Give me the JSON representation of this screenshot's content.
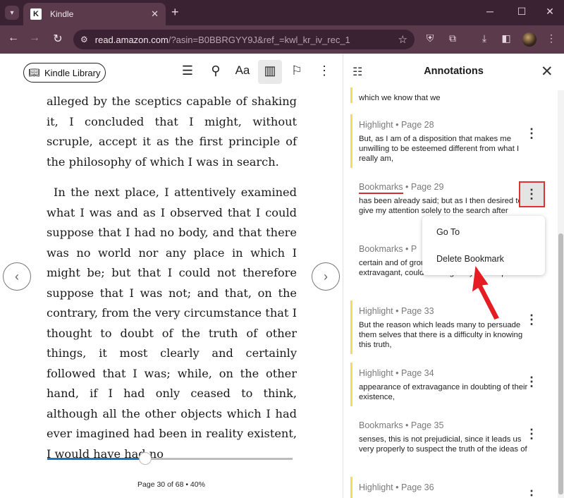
{
  "browser": {
    "tab_title": "Kindle",
    "tab_icon": "K",
    "url_host": "read.amazon.com",
    "url_path": "/?asin=B0BBRGYY9J&ref_=kwl_kr_iv_rec_1"
  },
  "reader": {
    "library_button": "Kindle Library",
    "text": [
      "alleged by the sceptics capable of shaking it, I concluded that I might, without scruple, accept it as the first principle of the philosophy of which I was in search.",
      "In the next place, I attentively examined what I was and as I observed that I could suppose that I had no body, and that there was no world nor any place in which I might be; but that I could not therefore suppose that I was not; and that, on the contrary, from the very circumstance that I thought to doubt of the truth of other things, it most clearly and certainly followed that I was; while, on the other hand, if I had only ceased to think, although all the other objects which I had ever imagined had been in reality existent, I would have had no"
    ],
    "progress": 0.4,
    "page_info": "Page 30 of 68 • 40%"
  },
  "panel": {
    "title": "Annotations",
    "notes": [
      {
        "meta_kind": "",
        "meta_page": "",
        "text": "which we know that we",
        "highlight": true
      },
      {
        "meta_kind": "Highlight",
        "meta_page": " • Page 28",
        "text": "But, as I am of a disposition that makes me unwilling to be esteemed different from what I really am,",
        "highlight": true
      },
      {
        "meta_kind": "Bookmarks",
        "meta_page": " • Page 29",
        "text": "has been already said; but as I then desired to give my attention solely to the search after",
        "highlight": false
      },
      {
        "meta_kind": "Bookmarks",
        "meta_page": " • P",
        "text": "certain and of ground of doubt, however extravagant, could be alleged by the sceptics",
        "highlight": false
      },
      {
        "meta_kind": "Highlight",
        "meta_page": " • Page 33",
        "text": "But the reason which leads many to persuade them selves that there is a difficulty in knowing this truth,",
        "highlight": true
      },
      {
        "meta_kind": "Highlight",
        "meta_page": " • Page 34",
        "text": "appearance of extravagance in doubting of their existence,",
        "highlight": true
      },
      {
        "meta_kind": "Bookmarks",
        "meta_page": " • Page 35",
        "text": "senses, this is not prejudicial, since it leads us very properly to suspect the truth of the ideas of",
        "highlight": false
      },
      {
        "meta_kind": "Highlight",
        "meta_page": " • Page 36",
        "text": "",
        "highlight": true
      }
    ],
    "menu": {
      "go_to": "Go To",
      "delete": "Delete Bookmark"
    }
  },
  "colors": {
    "accent": "#1f74c6",
    "highlight_bar": "#f1df5a",
    "callout": "#e03131"
  }
}
